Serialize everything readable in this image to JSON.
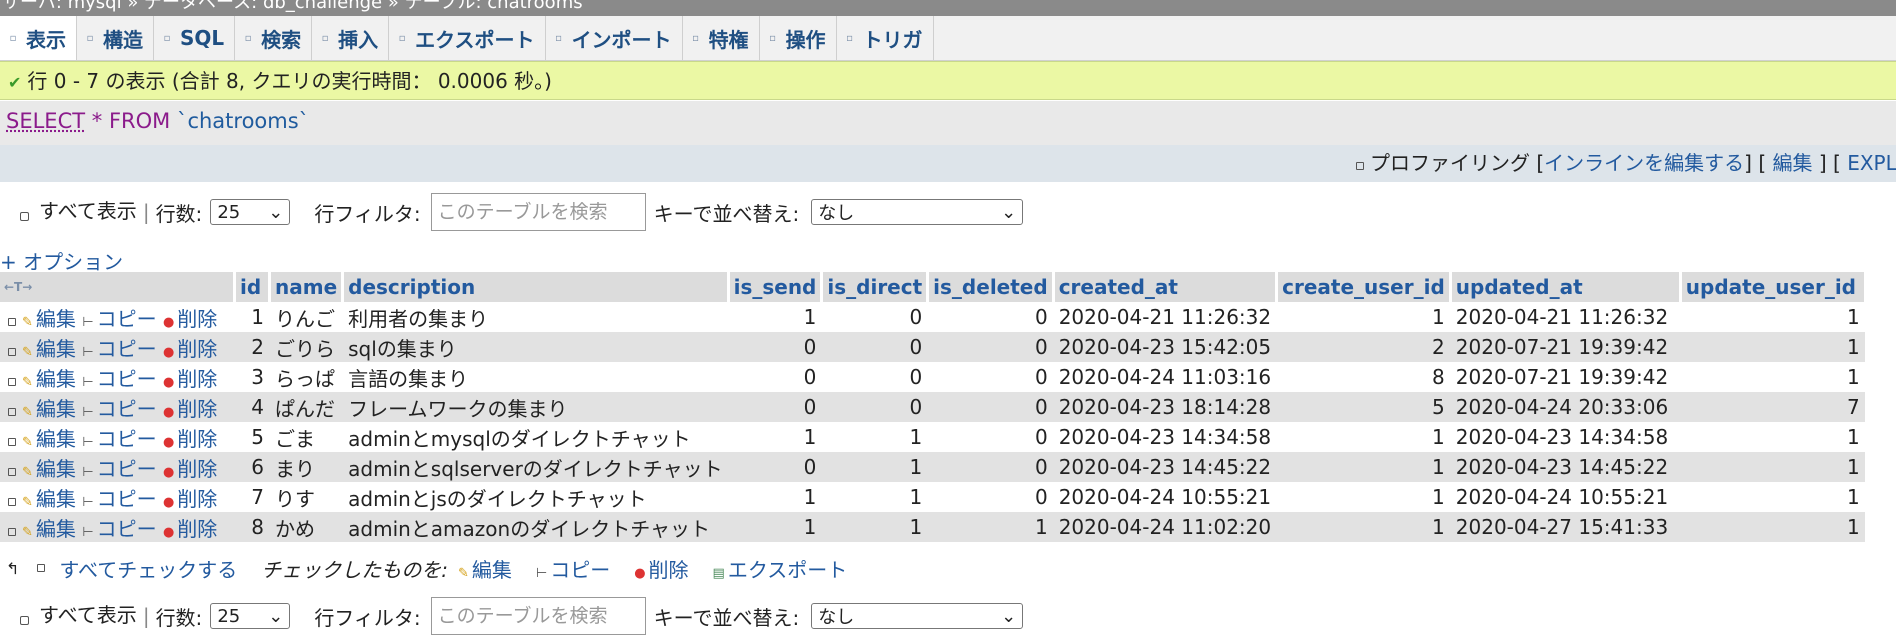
{
  "breadcrumb": "サーバ: mysql » データベース: db_challenge » テーブル: chatrooms",
  "tabs": [
    {
      "label": "表示",
      "icon": "browse-icon"
    },
    {
      "label": "構造",
      "icon": "structure-icon"
    },
    {
      "label": "SQL",
      "icon": "sql-icon"
    },
    {
      "label": "検索",
      "icon": "search-icon"
    },
    {
      "label": "挿入",
      "icon": "insert-icon"
    },
    {
      "label": "エクスポート",
      "icon": "export-icon"
    },
    {
      "label": "インポート",
      "icon": "import-icon"
    },
    {
      "label": "特権",
      "icon": "privileges-icon"
    },
    {
      "label": "操作",
      "icon": "operations-icon"
    },
    {
      "label": "トリガ",
      "icon": "triggers-icon"
    }
  ],
  "message": "行 0 - 7 の表示 (合計 8, クエリの実行時間： 0.0006 秒。)",
  "sql": {
    "select": "SELECT",
    "star": "*",
    "from": "FROM",
    "table": "`chatrooms`"
  },
  "sql_links": {
    "profiling": "プロファイリング",
    "open_bracket": "[",
    "inline_edit": "インラインを編集する",
    "close_bracket": "]",
    "open_bracket2": "[",
    "edit": "編集",
    "close_bracket2": "]",
    "open_bracket3": "[",
    "explain": "EXPLAIN SQL"
  },
  "nav": {
    "show_all": "すべて表示",
    "sep": "|",
    "rows_label": "行数:",
    "rows_value": "25",
    "filter_label": "行フィルタ:",
    "filter_placeholder": "このテーブルを検索",
    "sort_label": "キーで並べ替え:",
    "sort_value": "なし"
  },
  "options_link": "+ オプション",
  "columns": [
    "id",
    "name",
    "description",
    "is_send",
    "is_direct",
    "is_deleted",
    "created_at",
    "create_user_id",
    "updated_at",
    "update_user_id"
  ],
  "row_actions": {
    "edit": "編集",
    "copy": "コピー",
    "delete": "削除"
  },
  "rows": [
    [
      "1",
      "りんご",
      "利用者の集まり",
      "1",
      "0",
      "0",
      "2020-04-21 11:26:32",
      "1",
      "2020-04-21 11:26:32",
      "1"
    ],
    [
      "2",
      "ごりら",
      "sqlの集まり",
      "0",
      "0",
      "0",
      "2020-04-23 15:42:05",
      "2",
      "2020-07-21 19:39:42",
      "1"
    ],
    [
      "3",
      "らっぱ",
      "言語の集まり",
      "0",
      "0",
      "0",
      "2020-04-24 11:03:16",
      "8",
      "2020-07-21 19:39:42",
      "1"
    ],
    [
      "4",
      "ぱんだ",
      "フレームワークの集まり",
      "0",
      "0",
      "0",
      "2020-04-23 18:14:28",
      "5",
      "2020-04-24 20:33:06",
      "7"
    ],
    [
      "5",
      "ごま",
      "adminとmysqlのダイレクトチャット",
      "1",
      "1",
      "0",
      "2020-04-23 14:34:58",
      "1",
      "2020-04-23 14:34:58",
      "1"
    ],
    [
      "6",
      "まり",
      "adminとsqlserverのダイレクトチャット",
      "0",
      "1",
      "0",
      "2020-04-23 14:45:22",
      "1",
      "2020-04-23 14:45:22",
      "1"
    ],
    [
      "7",
      "りす",
      "adminとjsのダイレクトチャット",
      "1",
      "1",
      "0",
      "2020-04-24 10:55:21",
      "1",
      "2020-04-24 10:55:21",
      "1"
    ],
    [
      "8",
      "かめ",
      "adminとamazonのダイレクトチャット",
      "1",
      "1",
      "1",
      "2020-04-24 11:02:20",
      "1",
      "2020-04-27 15:41:33",
      "1"
    ]
  ],
  "bulk": {
    "check_all": "すべてチェックする",
    "with_selected": "チェックしたものを:",
    "edit": "編集",
    "copy": "コピー",
    "delete": "削除",
    "export": "エクスポート"
  },
  "colors": {
    "link": "#235a9f",
    "success_bg": "#ebf8a4",
    "row_alt": "#e2e2e2",
    "header_bg": "#dcdcdc"
  }
}
